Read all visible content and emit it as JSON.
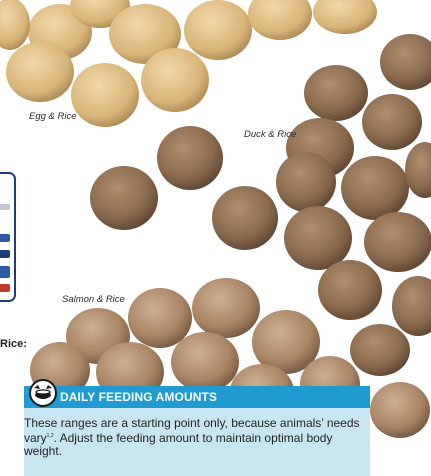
{
  "photo": {
    "labels": {
      "egg_rice": "Egg & Rice",
      "duck_rice": "Duck & Rice",
      "salmon_rice": "Salmon & Rice",
      "left_edge_bold": "Rice:"
    },
    "colors": {
      "background": "#ffffff",
      "egg_kibble": "#d8b579",
      "duck_kibble": "#8a6a4e",
      "salmon_kibble": "#a88565",
      "package_border": "#1f3d78"
    }
  },
  "feeding_box": {
    "title": "DAILY FEEDING AMOUNTS",
    "body_lead": "These ranges are a starting point only, because animals’ needs vary",
    "body_superscript": "1,2",
    "body_tail": ". Adjust the feeding amount to maintain optimal body weight.",
    "icon": "dog-bowl-icon",
    "colors": {
      "header": "#1f9bd1",
      "panel": "#c8e6f1"
    }
  }
}
